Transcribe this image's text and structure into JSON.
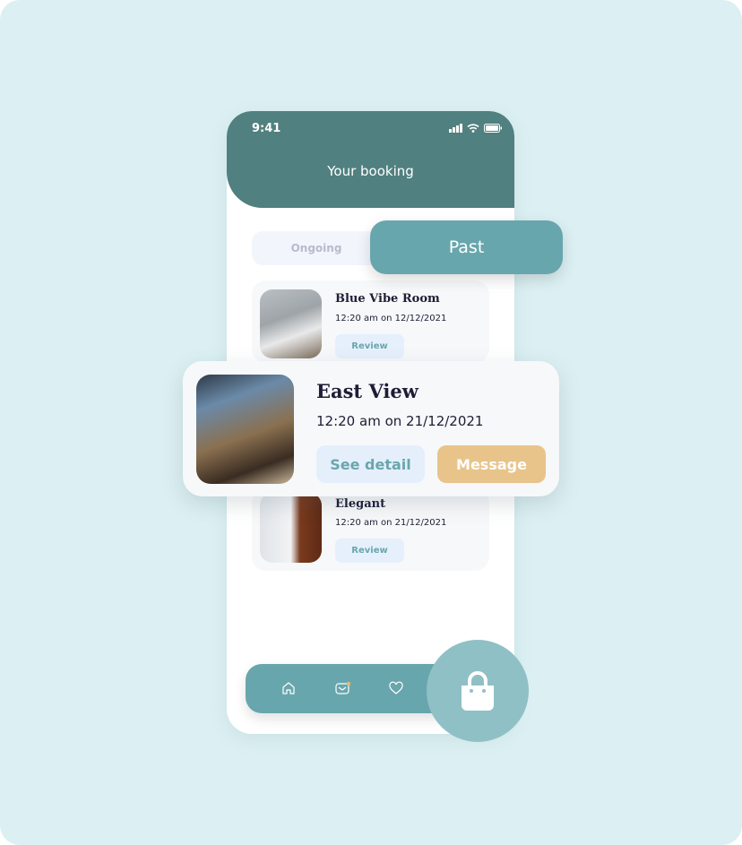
{
  "status_bar": {
    "time": "9:41"
  },
  "header": {
    "title": "Your booking"
  },
  "tabs": [
    {
      "label": "Ongoing",
      "active": false
    },
    {
      "label": "Past",
      "active": true
    }
  ],
  "bookings": [
    {
      "name": "Blue Vibe Room",
      "datetime": "12:20 am on 12/12/2021",
      "action": "Review"
    },
    {
      "name": "East View",
      "datetime": "12:20 am on 21/12/2021",
      "actions": [
        "See detail",
        "Message"
      ]
    },
    {
      "name": "Elegant",
      "datetime": "12:20 am on 21/12/2021",
      "action": "Review"
    }
  ],
  "nav": {
    "icons": [
      "home-icon",
      "mail-icon",
      "heart-icon",
      "shopping-bag-icon"
    ]
  },
  "colors": {
    "background": "#dcf0f3",
    "header": "#50807f",
    "accent": "#68a6ad",
    "message": "#e8c48b",
    "bag_button": "#8fc0c5",
    "notification_dot": "#e8b86b"
  }
}
